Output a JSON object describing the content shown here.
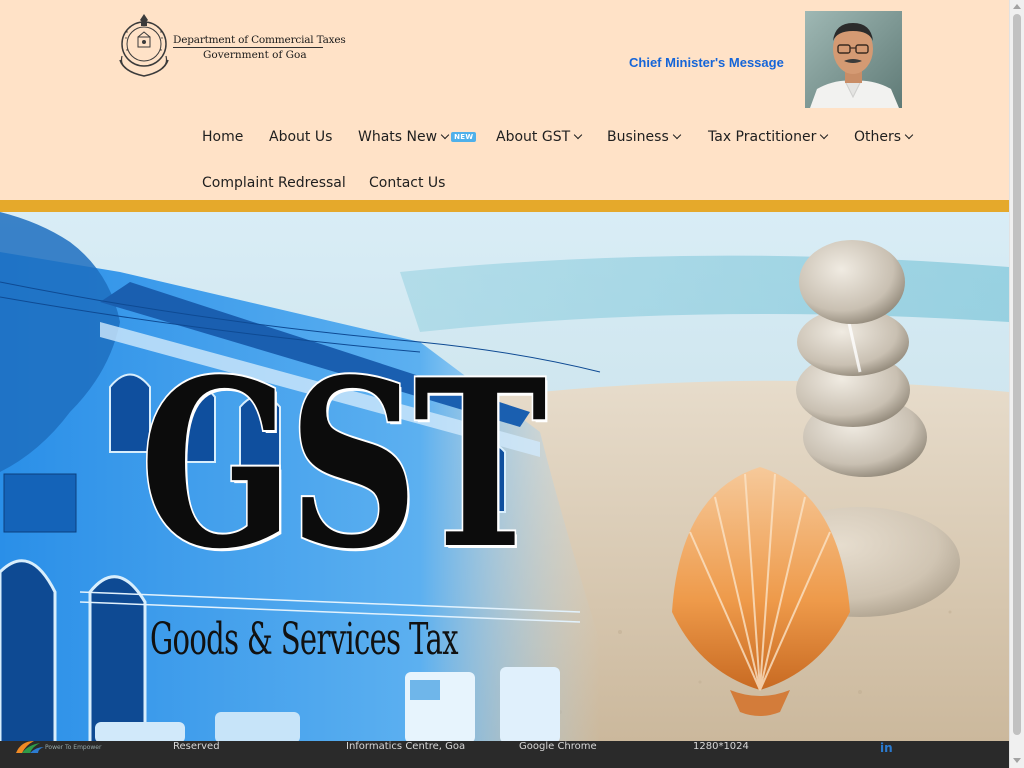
{
  "header": {
    "logo": {
      "line1": "Department of Commercial Taxes",
      "line2": "Government of Goa"
    },
    "cm_message_link": "Chief Minister's Message"
  },
  "nav": {
    "items": [
      {
        "label": "Home",
        "has_dropdown": false
      },
      {
        "label": "About Us",
        "has_dropdown": false
      },
      {
        "label": "Whats New",
        "has_dropdown": true,
        "badge": "NEW"
      },
      {
        "label": "About GST",
        "has_dropdown": true
      },
      {
        "label": "Business",
        "has_dropdown": true
      },
      {
        "label": "Tax Practitioner",
        "has_dropdown": true
      },
      {
        "label": "Others",
        "has_dropdown": true
      },
      {
        "label": "Complaint Redressal",
        "has_dropdown": false
      },
      {
        "label": "Contact Us",
        "has_dropdown": false
      }
    ]
  },
  "banner": {
    "title": "GST",
    "subtitle": "Goods & Services Tax"
  },
  "footer": {
    "tagline": "Power To Empower",
    "reserved": "Reserved",
    "nic": "Informatics Centre, Goa",
    "browser": "Google Chrome",
    "resolution": "1280*1024",
    "linkedin": "in"
  },
  "colors": {
    "header_bg": "#ffe2c7",
    "accent_bar": "#e5a92b",
    "link": "#1565d8",
    "footer_bg": "#2a2a2a"
  }
}
